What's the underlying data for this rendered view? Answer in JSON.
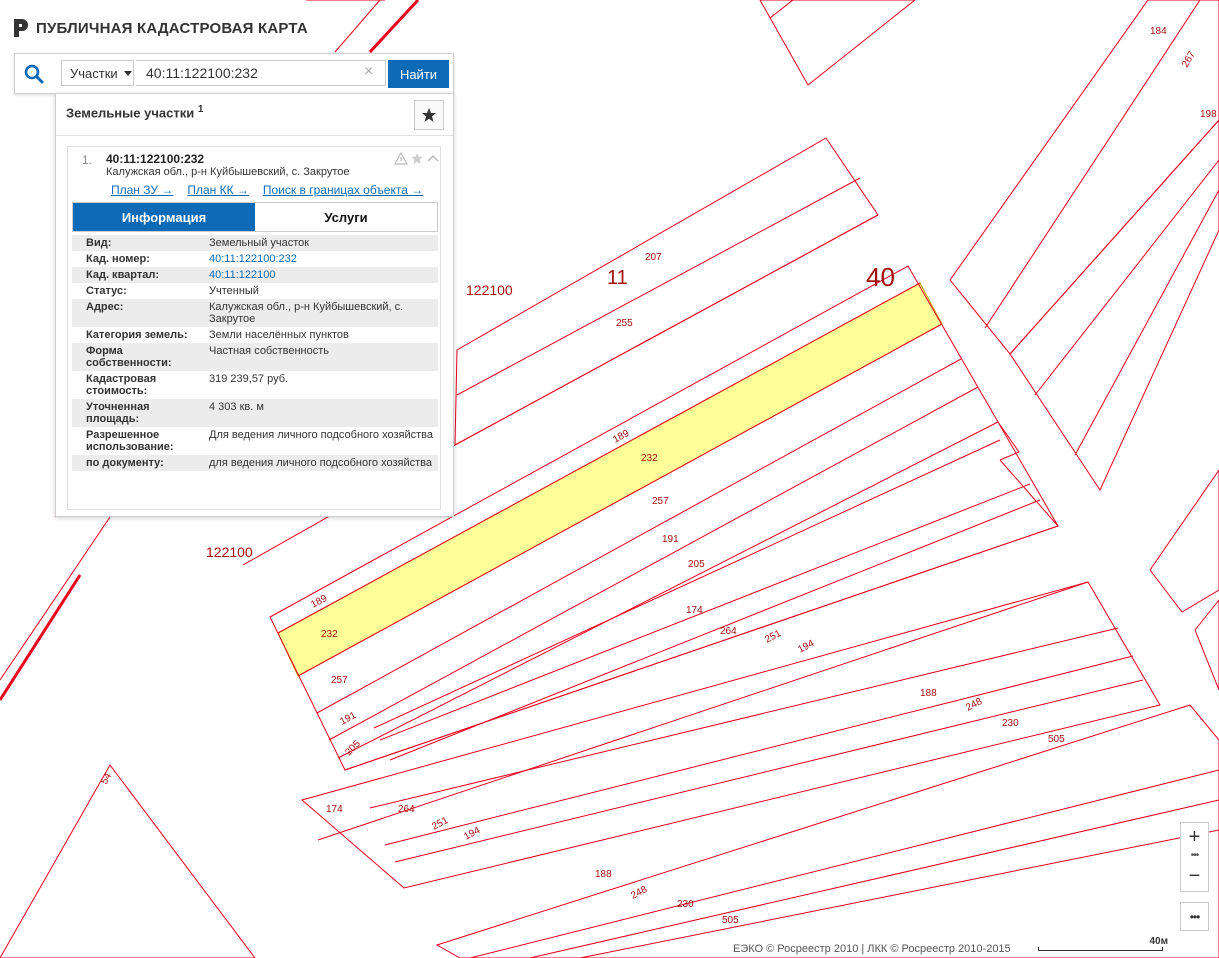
{
  "app": {
    "title": "ПУБЛИЧНАЯ КАДАСТРОВАЯ КАРТА"
  },
  "search": {
    "type_label": "Участки",
    "value": "40:11:122100:232",
    "clear_label": "×",
    "button_label": "Найти"
  },
  "panel": {
    "heading": "Земельные участки",
    "count": "1",
    "result": {
      "index": "1.",
      "title": "40:11:122100:232",
      "address": "Калужская обл., р-н Куйбышевский, с. Закрутое",
      "links": [
        "План ЗУ →",
        "План КК →",
        "Поиск в границах объекта →"
      ],
      "tabs": [
        "Информация",
        "Услуги"
      ],
      "info": [
        {
          "key": "Вид:",
          "value": "Земельный участок"
        },
        {
          "key": "Кад. номер:",
          "value": "40:11:122100:232",
          "link": true
        },
        {
          "key": "Кад. квартал:",
          "value": "40:11:122100",
          "link": true
        },
        {
          "key": "Статус:",
          "value": "Учтенный"
        },
        {
          "key": "Адрес:",
          "value": "Калужская обл., р-н Куйбышевский, с. Закрутое"
        },
        {
          "key": "Категория земель:",
          "value": "Земли населённых пунктов"
        },
        {
          "key": "Форма собственности:",
          "value": "Частная собственность"
        },
        {
          "key": "Кадастровая стоимость:",
          "value": "319 239,57 руб."
        },
        {
          "key": "Уточненная площадь:",
          "value": "4 303 кв. м"
        },
        {
          "key": "Разрешенное использование:",
          "value": "Для ведения личного подсобного хозяйства"
        },
        {
          "key": "по документу:",
          "value": "для ведения личного подсобного хозяйства"
        }
      ]
    }
  },
  "map": {
    "parcel_color": "#e8001c",
    "highlight_color": "#ffff99",
    "labels": {
      "quarter_a": "122100",
      "quarter_b": "122100",
      "district": "11",
      "region": "40",
      "p184": "184",
      "p267": "267",
      "p198": "198",
      "p207": "207",
      "p255": "255",
      "p189": "189",
      "p232": "232",
      "p257": "257",
      "p191": "191",
      "p205": "205",
      "p174": "174",
      "p264": "264",
      "p251": "251",
      "p194": "194",
      "p188": "188",
      "p248": "248",
      "p230": "230",
      "p505": "505",
      "p54": "54",
      "p189b": "189",
      "p232b": "232",
      "p257b": "257",
      "p191b": "191",
      "p205b": "205",
      "p174b": "174",
      "p264b": "264",
      "p251b": "251",
      "p194b": "194",
      "p188b": "188",
      "p248b": "248",
      "p230b": "230",
      "p505b": "505"
    }
  },
  "controls": {
    "zoom_in": "+",
    "zoom_out": "−",
    "dots": "•••",
    "more": "•••"
  },
  "attribution": "ЕЭКО © Росреестр 2010 | ЛКК © Росреестр 2010-2015",
  "scale_label": "40м"
}
